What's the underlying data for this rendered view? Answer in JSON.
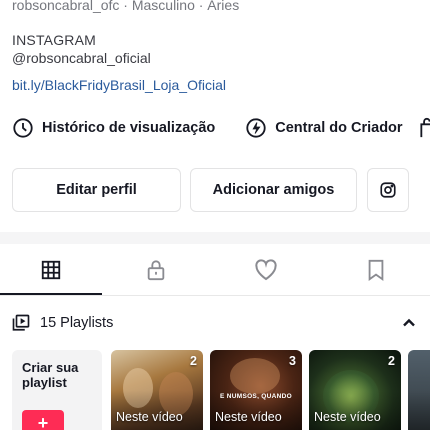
{
  "profile": {
    "meta": "robsoncabral_ofc · Masculino · Áries",
    "bio_line1": "INSTAGRAM",
    "bio_line2": "@robsoncabral_oficial",
    "link": "bit.ly/BlackFridyBrasil_Loja_Oficial"
  },
  "quick_links": [
    {
      "label": "Histórico de visualização",
      "icon": "clock-icon"
    },
    {
      "label": "Central do Criador",
      "icon": "lightning-icon"
    }
  ],
  "actions": {
    "edit_label": "Editar perfil",
    "add_friends_label": "Adicionar amigos",
    "instagram_icon": "instagram-icon"
  },
  "tabs": [
    {
      "name": "videos",
      "icon": "grid-icon",
      "active": true
    },
    {
      "name": "private",
      "icon": "lock-icon",
      "active": false
    },
    {
      "name": "liked",
      "icon": "heart-icon",
      "active": false
    },
    {
      "name": "favorites",
      "icon": "bookmark-icon",
      "active": false
    }
  ],
  "playlists": {
    "count_label": "15 Playlists",
    "create_label": "Criar sua playlist",
    "create_button": "+",
    "items": [
      {
        "count": "2",
        "caption": "Neste vídeo",
        "thumb_text": ""
      },
      {
        "count": "3",
        "caption": "Neste vídeo",
        "thumb_text": "E NUMSOS, QUANDO"
      },
      {
        "count": "2",
        "caption": "Neste vídeo",
        "thumb_text": ""
      },
      {
        "count": "",
        "caption": "",
        "thumb_text": ""
      }
    ]
  },
  "colors": {
    "accent": "#fe2c55",
    "link": "#2a5a9c",
    "text": "#161823",
    "muted": "#75777e"
  }
}
